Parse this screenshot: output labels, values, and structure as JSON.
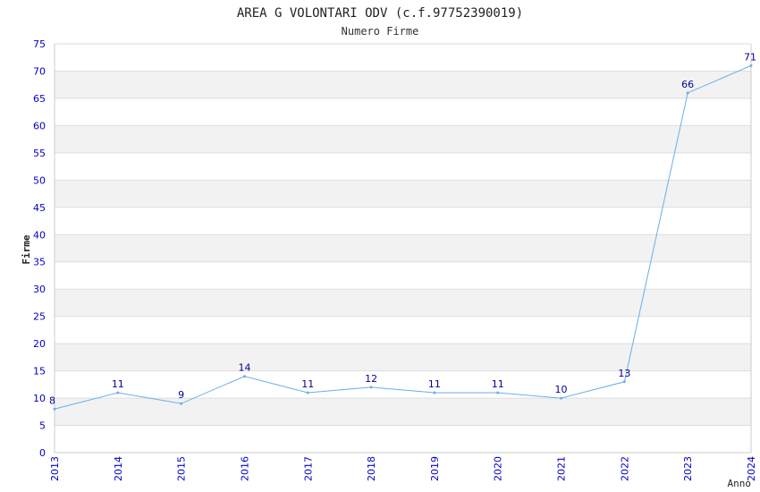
{
  "chart_data": {
    "type": "line",
    "title": "AREA G VOLONTARI ODV (c.f.97752390019)",
    "subtitle": "Numero Firme",
    "xlabel": "Anno",
    "ylabel": "Firme",
    "x": [
      "2013",
      "2014",
      "2015",
      "2016",
      "2017",
      "2018",
      "2019",
      "2020",
      "2021",
      "2022",
      "2023",
      "2024"
    ],
    "series": [
      {
        "values": [
          8,
          11,
          9,
          14,
          11,
          12,
          11,
          11,
          10,
          13,
          66,
          71
        ]
      }
    ],
    "ylim": [
      0,
      75
    ],
    "yticks": [
      0,
      5,
      10,
      15,
      20,
      25,
      30,
      35,
      40,
      45,
      50,
      55,
      60,
      65,
      70,
      75
    ],
    "grid": "horizontal bands",
    "colors": {
      "line": "#6aaee8",
      "tick_text": "#0000cc",
      "label_text": "#000099",
      "band": "#f2f2f2",
      "grid": "#dddddd",
      "axis": "#cccccc",
      "title_text": "#222222"
    }
  }
}
